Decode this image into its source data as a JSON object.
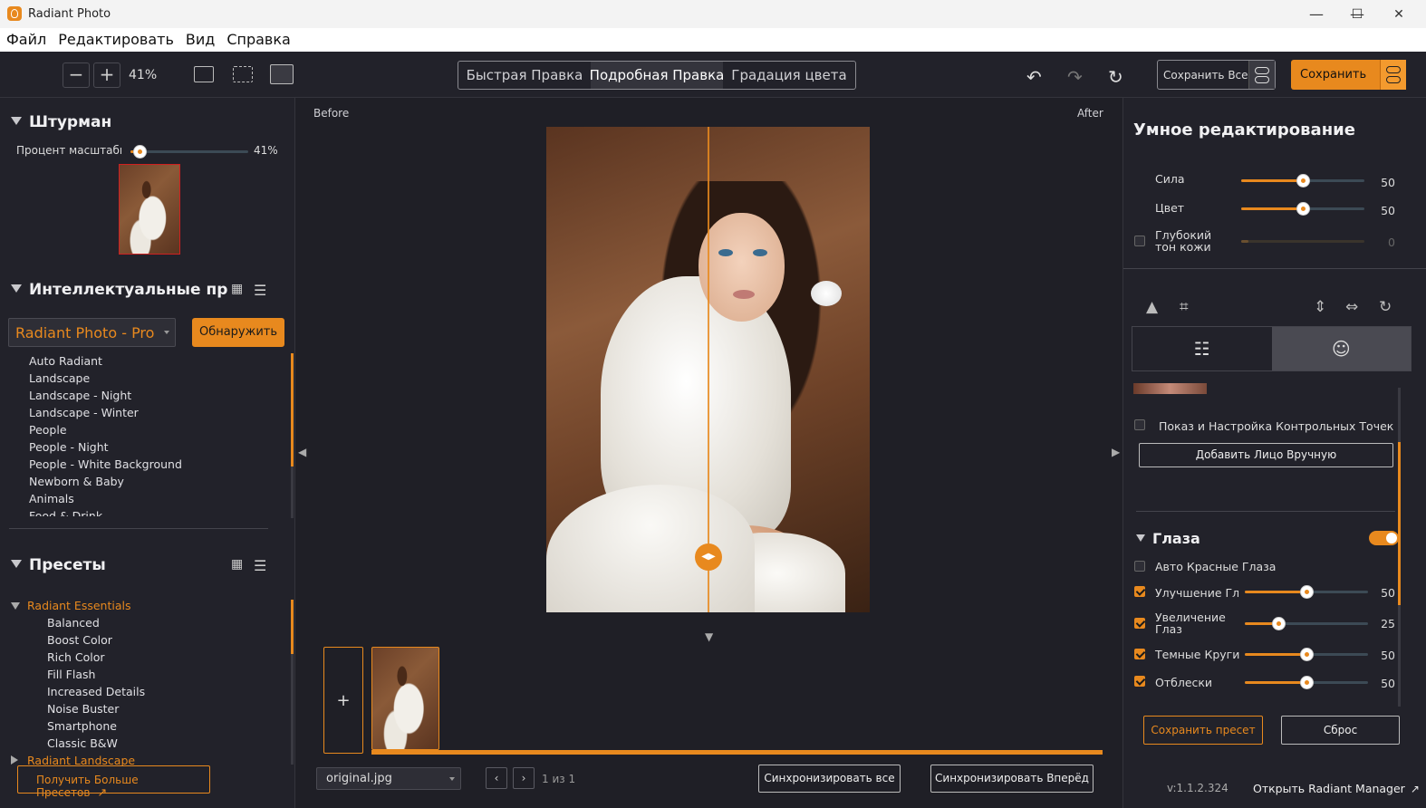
{
  "titlebar": {
    "title": "Radiant Photo",
    "min": "—",
    "max": "☐",
    "close": "✕"
  },
  "menu": [
    "Файл",
    "Редактировать",
    "Вид",
    "Справка"
  ],
  "toolbar": {
    "zoom_out": "−",
    "zoom_in": "+",
    "zoom": "41%",
    "modes": [
      "Быстрая Правка",
      "Подробная Правка",
      "Градация цвета"
    ],
    "active_mode": "Подробная Правка",
    "undo": "↶",
    "redo": "↷",
    "reset": "↻",
    "save_all": "Сохранить Все",
    "save": "Сохранить",
    "accent": "#e8891e"
  },
  "navigator": {
    "title": "Штурман",
    "zoom_label": "Процент масштабирования",
    "zoom_value": "41%"
  },
  "smart_presets": {
    "title": "Интеллектуальные пресеты",
    "selected": "Radiant Photo - Pro",
    "detect": "Обнаружить",
    "items": [
      "Auto Radiant",
      "Landscape",
      "Landscape - Night",
      "Landscape - Winter",
      "People",
      "People - Night",
      "People - White Background",
      "Newborn & Baby",
      "Animals",
      "Food & Drink"
    ]
  },
  "presets": {
    "title": "Пресеты",
    "group_open": "Radiant Essentials",
    "items": [
      "Balanced",
      "Boost Color",
      "Rich Color",
      "Fill Flash",
      "Increased Details",
      "Noise Buster",
      "Smartphone",
      "Classic B&W"
    ],
    "group_closed": "Radiant Landscape",
    "get_more": "Получить Больше Пресетов"
  },
  "viewer": {
    "before": "Before",
    "after": "After"
  },
  "filmstrip": {
    "add": "+",
    "filename": "original.jpg",
    "prev": "‹",
    "next": "›",
    "page": "1 из 1",
    "sync_all": "Синхронизировать все",
    "sync_forward": "Синхронизировать Вперёд"
  },
  "right_panel": {
    "title": "Умное редактирование",
    "strength": {
      "label": "Сила",
      "value": "50",
      "level": 50
    },
    "color": {
      "label": "Цвет",
      "value": "50",
      "level": 50
    },
    "deep_skin": {
      "label": "Глубокий тон кожи",
      "value": "0",
      "level": 0
    },
    "show_points": "Показ и Настройка Контрольных Точек",
    "add_face": "Добавить Лицо Вручную",
    "eyes": {
      "title": "Глаза",
      "auto_red": "Авто Красные Глаза",
      "rows": [
        {
          "label": "Улучшение Глаз",
          "value": "50",
          "level": 50
        },
        {
          "label": "Увеличение Глаз",
          "value": "25",
          "level": 25
        },
        {
          "label": "Темные Круги",
          "value": "50",
          "level": 50
        },
        {
          "label": "Отблески",
          "value": "50",
          "level": 50
        }
      ]
    },
    "save_preset": "Сохранить пресет",
    "reset": "Сброс",
    "version": "v:1.1.2.324",
    "open_manager": "Открыть Radiant Manager"
  }
}
